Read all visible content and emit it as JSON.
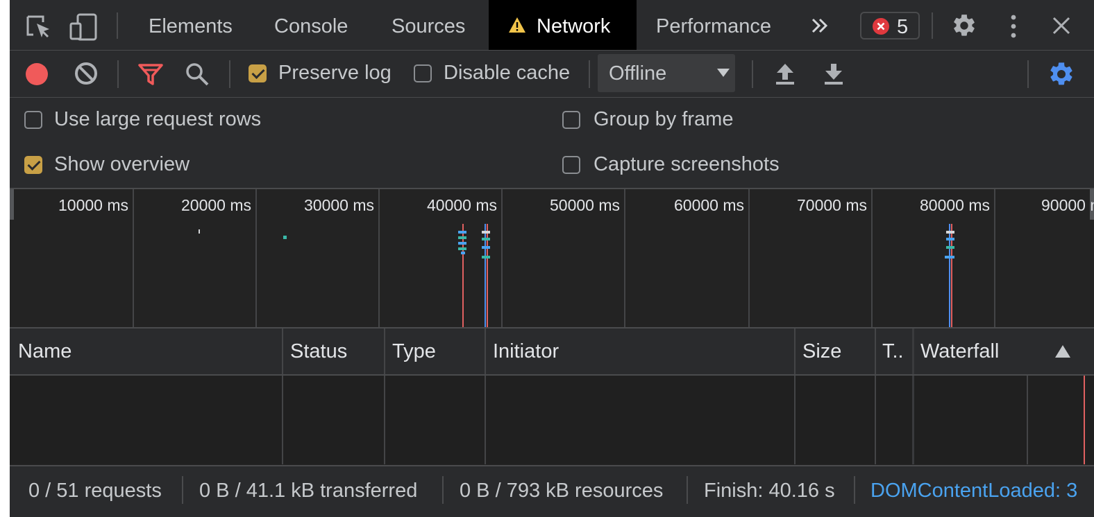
{
  "tabs": [
    {
      "label": "Elements",
      "active": false
    },
    {
      "label": "Console",
      "active": false
    },
    {
      "label": "Sources",
      "active": false
    },
    {
      "label": "Network",
      "active": true,
      "warning": true
    },
    {
      "label": "Performance",
      "active": false
    }
  ],
  "error_count": "5",
  "toolbar": {
    "preserve_log_label": "Preserve log",
    "preserve_log_checked": true,
    "disable_cache_label": "Disable cache",
    "disable_cache_checked": false,
    "throttle_value": "Offline"
  },
  "settings": {
    "large_rows_label": "Use large request rows",
    "show_overview_label": "Show overview",
    "group_by_frame_label": "Group by frame",
    "capture_screenshots_label": "Capture screenshots"
  },
  "overview_ticks": [
    "10000 ms",
    "20000 ms",
    "30000 ms",
    "40000 ms",
    "50000 ms",
    "60000 ms",
    "70000 ms",
    "80000 ms",
    "90000 ms"
  ],
  "columns": {
    "name": "Name",
    "status": "Status",
    "type": "Type",
    "initiator": "Initiator",
    "size": "Size",
    "time": "T..",
    "waterfall": "Waterfall"
  },
  "status_bar": {
    "requests": "0 / 51 requests",
    "transferred": "0 B / 41.1 kB transferred",
    "resources": "0 B / 793 kB resources",
    "finish": "Finish: 40.16 s",
    "dom_loaded": "DOMContentLoaded: 3"
  },
  "colors": {
    "record_red": "#f05a5a",
    "accent_blue": "#4f8ff0",
    "checkbox_gold": "#c8a046",
    "warning_yellow": "#f2c44a",
    "dom_link_blue": "#4aa3f0"
  }
}
